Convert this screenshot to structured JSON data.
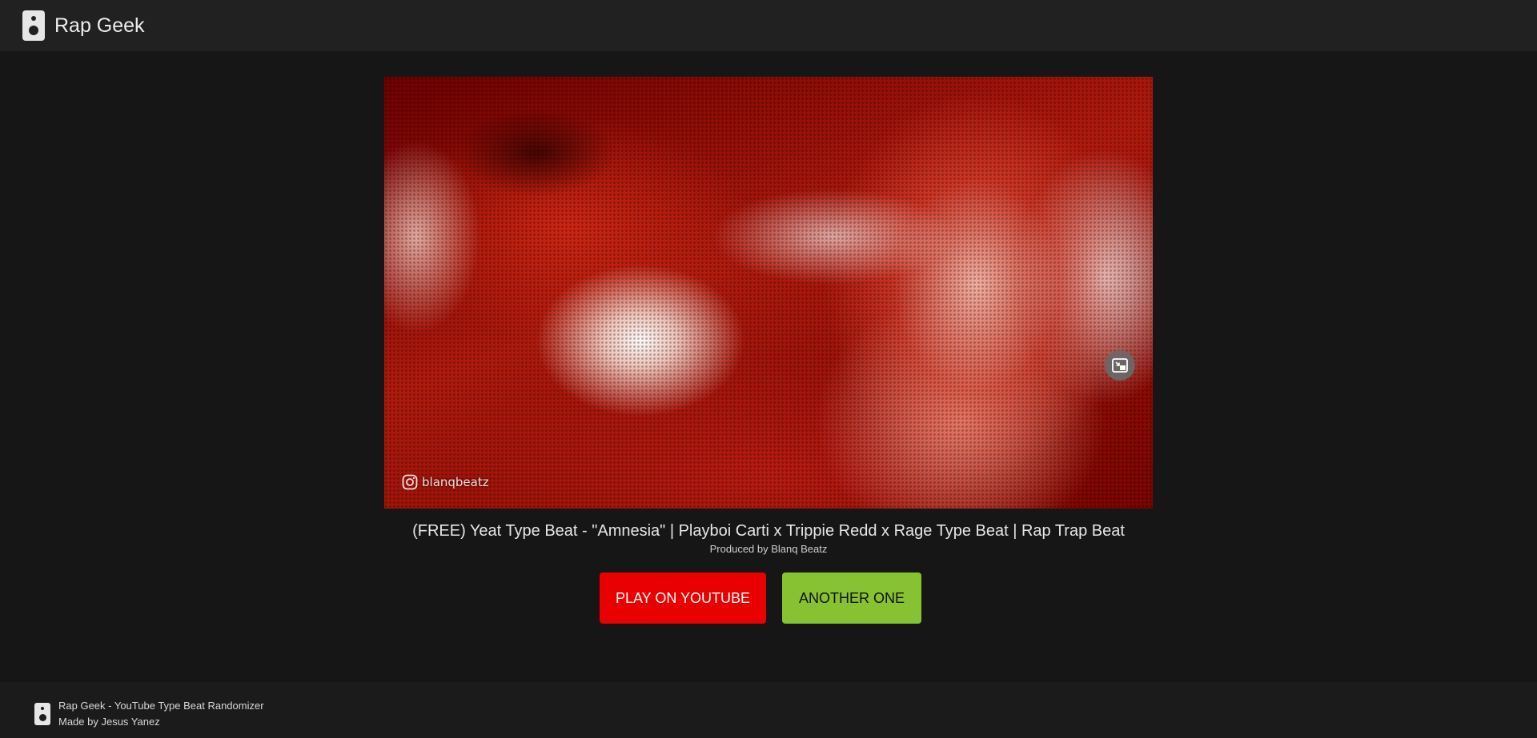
{
  "header": {
    "app_name": "Rap Geek",
    "logo_icon": "speaker-icon"
  },
  "video": {
    "watermark": "blanqbeatz",
    "watermark_icon": "instagram-icon",
    "pip_icon": "picture-in-picture-icon"
  },
  "track": {
    "title": "(FREE) Yeat Type Beat - \"Amnesia\" | Playboi Carti x Trippie Redd x Rage Type Beat | Rap Trap Beat",
    "producer": "Produced by Blanq Beatz"
  },
  "actions": {
    "play_youtube_label": "PLAY ON YOUTUBE",
    "another_one_label": "ANOTHER ONE"
  },
  "footer": {
    "line1": "Rap Geek - YouTube Type Beat Randomizer",
    "line2": "Made by Jesus Yanez",
    "logo_icon": "speaker-icon"
  },
  "colors": {
    "youtube_red": "#e90000",
    "accent_green": "#86c232",
    "background": "#161616",
    "header_bg": "#212121"
  }
}
